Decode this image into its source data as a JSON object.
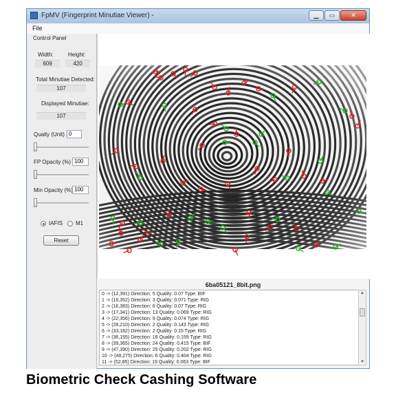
{
  "window": {
    "title": "FpMV (Fingerprint Minutiae Viewer) -",
    "buttons": [
      "▁",
      "▭",
      "✕"
    ]
  },
  "menu": {
    "file": "File"
  },
  "control_panel": {
    "heading": "Control Panel",
    "width_label": "Width:",
    "width_value": "609",
    "height_label": "Height:",
    "height_value": "420",
    "total_label": "Total Minutiae Detected:",
    "total_value": "107",
    "displayed_label": "Displayed Minutiae:",
    "displayed_value": "107",
    "quality_label": "Qualty (Unit) >",
    "quality_value": "0",
    "quality_slider": 0,
    "fp_opacity_label": "FP Opacity (%) >",
    "fp_opacity_value": "100",
    "fp_opacity_slider": 0,
    "min_opacity_label": "Min Opacity (%) >",
    "min_opacity_value": "100",
    "min_opacity_slider": 0,
    "radio_iafis": "IAFIS",
    "radio_m1": "M1",
    "selected_format": "IAFIS",
    "reset_label": "Reset"
  },
  "file_name": "6ba05121_8bit.png",
  "minutiae_list": [
    "0 -> (12,391)  Direction: 5  Quality: 0.07  Type: BIF",
    "1 -> (16,352)  Direction: 3  Quality: 0.071  Type: RIG",
    "2 -> (16,383)  Direction: 6  Quality: 0.07  Type: RIG",
    "3 -> (17,341)  Direction: 13  Quality: 0.069  Type: RIG",
    "4 -> (22,356)  Direction: 9  Quality: 0.074  Type: RIG",
    "5 -> (28,210)  Direction: 2  Quality: 0.143  Type: RIG",
    "6 -> (33,182)  Direction: 2  Quality: 0.15  Type: RIG",
    "7 -> (36,155)  Direction: 18  Quality: 0.159  Type: RIG",
    "8 -> (39,365)  Direction: 24  Quality: 0.415  Type: BIF",
    "9 -> (47,390)  Direction: 25  Quality: 0.202  Type: RIG",
    "10 -> (48,275)  Direction: 6  Quality: 0.404  Type: RIG",
    "11 -> (52,85)  Direction: 19  Quality: 0.063  Type: BIF"
  ],
  "minutiae_colors": {
    "ridge_end": "#e02020",
    "bifurcation": "#2ab02a"
  },
  "caption": "Biometric Check Cashing Software"
}
